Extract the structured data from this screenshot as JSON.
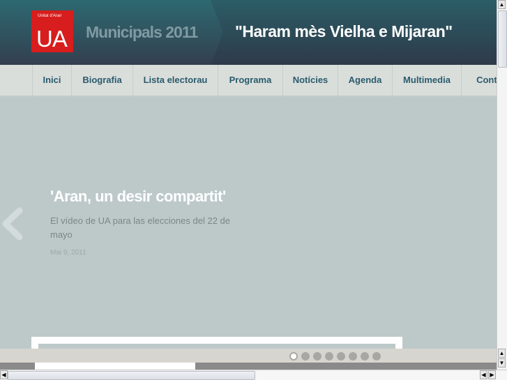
{
  "header": {
    "logo_small": "Unitat d'Aran",
    "logo_big": "UA",
    "title": "Municipals 2011",
    "slogan": "\"Haram mès Vielha e Mijaran\""
  },
  "nav": {
    "items": [
      {
        "label": "Inici"
      },
      {
        "label": "Biografia"
      },
      {
        "label": "Lista electorau"
      },
      {
        "label": "Programa"
      },
      {
        "label": "Notícies"
      },
      {
        "label": "Agenda"
      },
      {
        "label": "Multimedia"
      },
      {
        "label": "Conta"
      }
    ]
  },
  "slide": {
    "title": "'Aran, un desir compartit'",
    "description": "El vídeo de UA para las elecciones del 22 de mayo",
    "date": "Mai 9, 2011",
    "count": 8,
    "active_index": 0
  },
  "colors": {
    "logo": "#d71d1d",
    "nav_text": "#2a5a6c",
    "slide_bg": "#bdc9c9"
  }
}
